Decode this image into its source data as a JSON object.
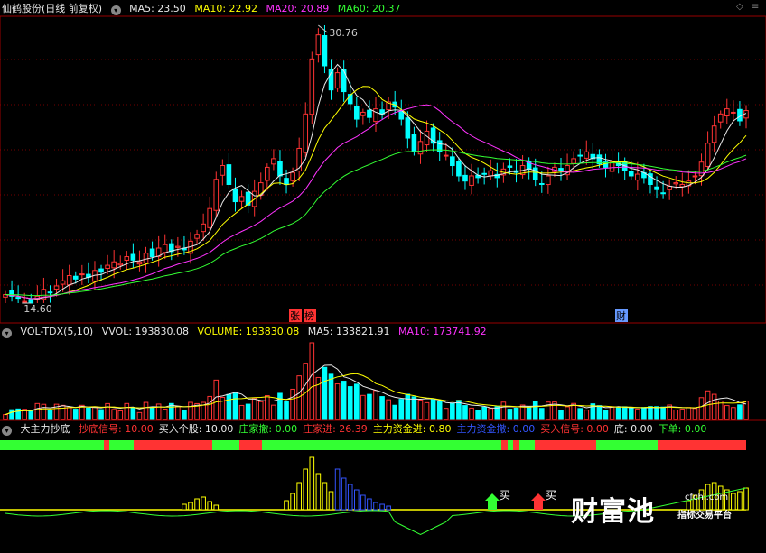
{
  "main_header": {
    "title": "仙鹤股份(日线 前复权)",
    "ma5": "MA5: 23.50",
    "ma10": "MA10: 22.92",
    "ma20": "MA20: 20.89",
    "ma60": "MA60: 20.37"
  },
  "corner_icons": [
    "diamond-icon",
    "menu-icon"
  ],
  "vol_header": {
    "name": "VOL-TDX(5,10)",
    "vvol": "VVOL: 193830.08",
    "volume": "VOLUME: 193830.08",
    "ma5": "MA5: 133821.91",
    "ma10": "MA10: 173741.92"
  },
  "ind_header": {
    "name": "大主力抄底",
    "items": [
      {
        "text": "抄底信号: 10.00",
        "color": "#ff3333"
      },
      {
        "text": "买入个股: 10.00",
        "color": "#e8e8e8"
      },
      {
        "text": "庄家撤: 0.00",
        "color": "#33ff33"
      },
      {
        "text": "庄家进: 26.39",
        "color": "#ff3333"
      },
      {
        "text": "主力资金进: 0.80",
        "color": "#ffff00"
      },
      {
        "text": "主力资金撤: 0.00",
        "color": "#3355ff"
      },
      {
        "text": "买入信号: 0.00",
        "color": "#ff3333"
      },
      {
        "text": "底: 0.00",
        "color": "#e8e8e8"
      },
      {
        "text": "下单: 0.00",
        "color": "#33ff33"
      }
    ]
  },
  "annotations": {
    "high_label": "30.76",
    "low_label": "14.60",
    "badge_zhang": "张",
    "badge_bang": "榜",
    "badge_cai": "财",
    "buy1": "买",
    "buy2": "买"
  },
  "watermark": {
    "main": "财富池",
    "site": "cfchi.com",
    "sub": "指标交易平台"
  },
  "colors": {
    "up": "#ff3333",
    "down": "#00ffff",
    "ma5": "#e8e8e8",
    "ma10": "#ffff00",
    "ma20": "#ff33ff",
    "ma60": "#33ff33",
    "grid": "#990000"
  },
  "chart_data": {
    "type": "candlestick",
    "price_range": [
      14.6,
      30.76
    ],
    "bars": 117,
    "closes": [
      15.1,
      15.0,
      14.9,
      14.7,
      14.6,
      15.0,
      15.4,
      15.2,
      15.6,
      15.9,
      16.2,
      16.0,
      16.3,
      16.1,
      16.5,
      16.4,
      16.8,
      17.0,
      16.9,
      17.3,
      17.1,
      17.0,
      17.5,
      17.3,
      17.8,
      18.0,
      17.6,
      17.9,
      17.7,
      18.2,
      18.6,
      19.2,
      20.1,
      21.8,
      22.6,
      21.5,
      20.5,
      20.8,
      20.3,
      21.1,
      21.6,
      22.5,
      23.0,
      22.0,
      21.5,
      22.2,
      23.6,
      25.6,
      28.8,
      30.2,
      28.4,
      27.0,
      28.0,
      26.9,
      26.2,
      25.3,
      25.7,
      25.4,
      25.9,
      25.6,
      26.3,
      26.0,
      25.3,
      24.2,
      23.4,
      24.0,
      24.6,
      23.9,
      23.4,
      23.2,
      22.6,
      22.0,
      21.7,
      22.0,
      21.9,
      22.1,
      22.3,
      21.9,
      22.4,
      22.5,
      22.2,
      22.6,
      22.4,
      21.8,
      21.5,
      22.0,
      22.5,
      22.3,
      22.6,
      23.0,
      23.2,
      23.4,
      23.0,
      22.7,
      22.5,
      22.8,
      22.6,
      22.3,
      22.0,
      22.1,
      21.9,
      21.5,
      21.2,
      21.0,
      21.4,
      21.6,
      21.5,
      21.7,
      22.0,
      22.8,
      23.9,
      24.9,
      25.6,
      25.9,
      25.7,
      25.2,
      25.8
    ],
    "ma60_series_name": "MA60"
  }
}
